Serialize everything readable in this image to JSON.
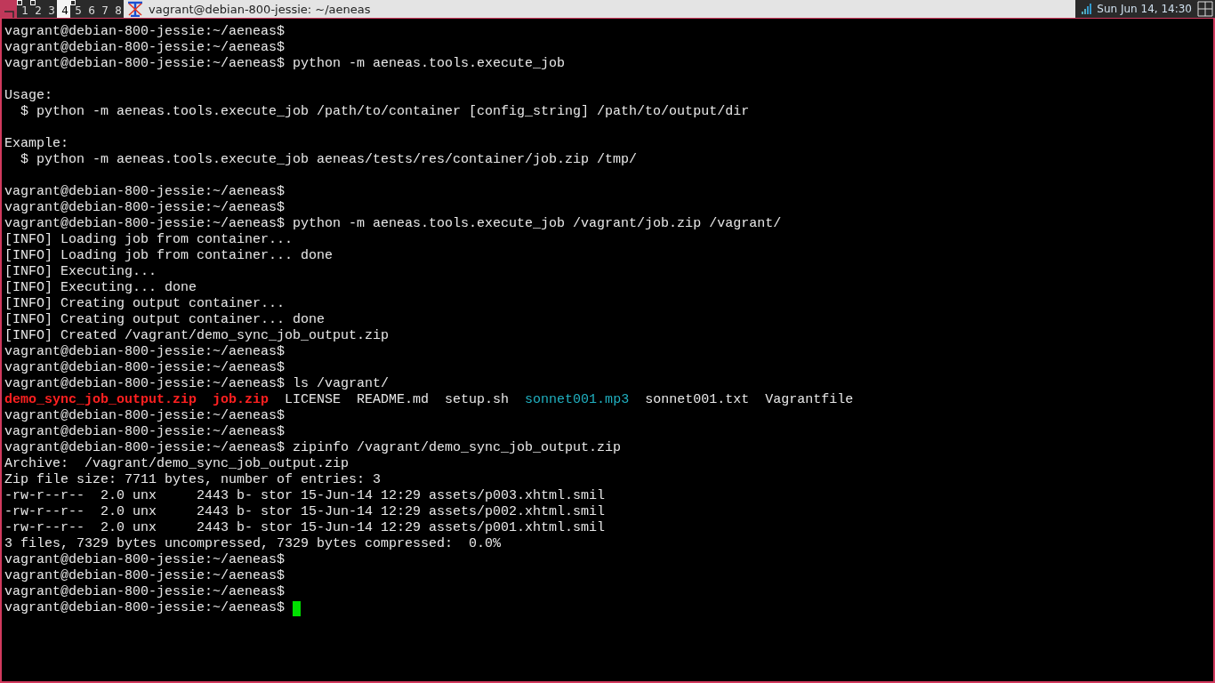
{
  "panel": {
    "workspaces": [
      {
        "label": "1",
        "selected": false,
        "occupied": true
      },
      {
        "label": "2",
        "selected": false,
        "occupied": true
      },
      {
        "label": "3",
        "selected": false,
        "occupied": false
      },
      {
        "label": "4",
        "selected": true,
        "occupied": false
      },
      {
        "label": "5",
        "selected": false,
        "occupied": true
      },
      {
        "label": "6",
        "selected": false,
        "occupied": false
      },
      {
        "label": "7",
        "selected": false,
        "occupied": false
      },
      {
        "label": "8",
        "selected": false,
        "occupied": false
      }
    ],
    "window_title": "vagrant@debian-800-jessie: ~/aeneas",
    "clock": "Sun Jun 14, 14:30"
  },
  "terminal": {
    "cursor": true,
    "lines": [
      {
        "kind": "text",
        "segments": [
          {
            "text": "vagrant@debian-800-jessie:~/aeneas$",
            "kind": "plain"
          }
        ]
      },
      {
        "kind": "text",
        "segments": [
          {
            "text": "vagrant@debian-800-jessie:~/aeneas$",
            "kind": "plain"
          }
        ]
      },
      {
        "kind": "text",
        "segments": [
          {
            "text": "vagrant@debian-800-jessie:~/aeneas$ python -m aeneas.tools.execute_job",
            "kind": "plain"
          }
        ]
      },
      {
        "kind": "blank"
      },
      {
        "kind": "text",
        "segments": [
          {
            "text": "Usage:",
            "kind": "plain"
          }
        ]
      },
      {
        "kind": "text",
        "segments": [
          {
            "text": "  $ python -m aeneas.tools.execute_job /path/to/container [config_string] /path/to/output/dir",
            "kind": "plain"
          }
        ]
      },
      {
        "kind": "blank"
      },
      {
        "kind": "text",
        "segments": [
          {
            "text": "Example:",
            "kind": "plain"
          }
        ]
      },
      {
        "kind": "text",
        "segments": [
          {
            "text": "  $ python -m aeneas.tools.execute_job aeneas/tests/res/container/job.zip /tmp/",
            "kind": "plain"
          }
        ]
      },
      {
        "kind": "blank"
      },
      {
        "kind": "text",
        "segments": [
          {
            "text": "vagrant@debian-800-jessie:~/aeneas$",
            "kind": "plain"
          }
        ]
      },
      {
        "kind": "text",
        "segments": [
          {
            "text": "vagrant@debian-800-jessie:~/aeneas$",
            "kind": "plain"
          }
        ]
      },
      {
        "kind": "text",
        "segments": [
          {
            "text": "vagrant@debian-800-jessie:~/aeneas$ python -m aeneas.tools.execute_job /vagrant/job.zip /vagrant/",
            "kind": "plain"
          }
        ]
      },
      {
        "kind": "text",
        "segments": [
          {
            "text": "[INFO] Loading job from container...",
            "kind": "plain"
          }
        ]
      },
      {
        "kind": "text",
        "segments": [
          {
            "text": "[INFO] Loading job from container... done",
            "kind": "plain"
          }
        ]
      },
      {
        "kind": "text",
        "segments": [
          {
            "text": "[INFO] Executing...",
            "kind": "plain"
          }
        ]
      },
      {
        "kind": "text",
        "segments": [
          {
            "text": "[INFO] Executing... done",
            "kind": "plain"
          }
        ]
      },
      {
        "kind": "text",
        "segments": [
          {
            "text": "[INFO] Creating output container...",
            "kind": "plain"
          }
        ]
      },
      {
        "kind": "text",
        "segments": [
          {
            "text": "[INFO] Creating output container... done",
            "kind": "plain"
          }
        ]
      },
      {
        "kind": "text",
        "segments": [
          {
            "text": "[INFO] Created /vagrant/demo_sync_job_output.zip",
            "kind": "plain"
          }
        ]
      },
      {
        "kind": "text",
        "segments": [
          {
            "text": "vagrant@debian-800-jessie:~/aeneas$",
            "kind": "plain"
          }
        ]
      },
      {
        "kind": "text",
        "segments": [
          {
            "text": "vagrant@debian-800-jessie:~/aeneas$",
            "kind": "plain"
          }
        ]
      },
      {
        "kind": "text",
        "segments": [
          {
            "text": "vagrant@debian-800-jessie:~/aeneas$ ls /vagrant/",
            "kind": "plain"
          }
        ]
      },
      {
        "kind": "text",
        "segments": [
          {
            "text": "demo_sync_job_output.zip",
            "kind": "archive"
          },
          {
            "text": "job.zip",
            "kind": "archive"
          },
          {
            "text": "LICENSE",
            "kind": "plain"
          },
          {
            "text": "README.md",
            "kind": "plain"
          },
          {
            "text": "setup.sh",
            "kind": "plain"
          },
          {
            "text": "sonnet001.mp3",
            "kind": "media"
          },
          {
            "text": "sonnet001.txt",
            "kind": "plain"
          },
          {
            "text": "Vagrantfile",
            "kind": "plain"
          }
        ]
      },
      {
        "kind": "text",
        "segments": [
          {
            "text": "vagrant@debian-800-jessie:~/aeneas$",
            "kind": "plain"
          }
        ]
      },
      {
        "kind": "text",
        "segments": [
          {
            "text": "vagrant@debian-800-jessie:~/aeneas$",
            "kind": "plain"
          }
        ]
      },
      {
        "kind": "text",
        "segments": [
          {
            "text": "vagrant@debian-800-jessie:~/aeneas$ zipinfo /vagrant/demo_sync_job_output.zip",
            "kind": "plain"
          }
        ]
      },
      {
        "kind": "text",
        "segments": [
          {
            "text": "Archive:  /vagrant/demo_sync_job_output.zip",
            "kind": "plain"
          }
        ]
      },
      {
        "kind": "text",
        "segments": [
          {
            "text": "Zip file size: 7711 bytes, number of entries: 3",
            "kind": "plain"
          }
        ]
      },
      {
        "kind": "text",
        "segments": [
          {
            "text": "-rw-r--r--  2.0 unx     2443 b- stor 15-Jun-14 12:29 assets/p003.xhtml.smil",
            "kind": "plain"
          }
        ]
      },
      {
        "kind": "text",
        "segments": [
          {
            "text": "-rw-r--r--  2.0 unx     2443 b- stor 15-Jun-14 12:29 assets/p002.xhtml.smil",
            "kind": "plain"
          }
        ]
      },
      {
        "kind": "text",
        "segments": [
          {
            "text": "-rw-r--r--  2.0 unx     2443 b- stor 15-Jun-14 12:29 assets/p001.xhtml.smil",
            "kind": "plain"
          }
        ]
      },
      {
        "kind": "text",
        "segments": [
          {
            "text": "3 files, 7329 bytes uncompressed, 7329 bytes compressed:  0.0%",
            "kind": "plain"
          }
        ]
      },
      {
        "kind": "text",
        "segments": [
          {
            "text": "vagrant@debian-800-jessie:~/aeneas$",
            "kind": "plain"
          }
        ]
      },
      {
        "kind": "text",
        "segments": [
          {
            "text": "vagrant@debian-800-jessie:~/aeneas$",
            "kind": "plain"
          }
        ]
      },
      {
        "kind": "text",
        "segments": [
          {
            "text": "vagrant@debian-800-jessie:~/aeneas$",
            "kind": "plain"
          }
        ]
      },
      {
        "kind": "text",
        "segments": [
          {
            "text": "vagrant@debian-800-jessie:~/aeneas$ ",
            "kind": "plain"
          }
        ]
      }
    ]
  }
}
